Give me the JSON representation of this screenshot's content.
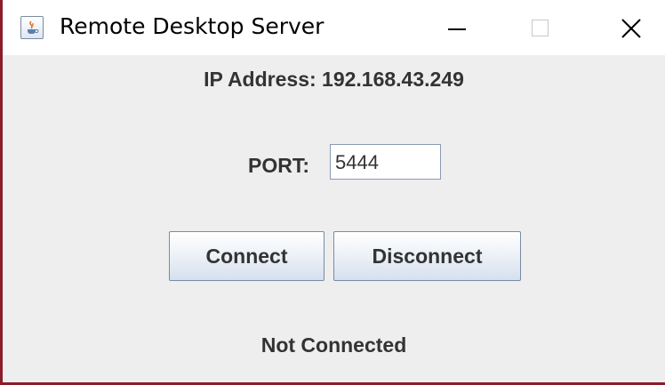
{
  "window": {
    "title": "Remote Desktop Server",
    "icon": "java-cup-icon",
    "controls": [
      "minimize-icon",
      "maximize-icon",
      "close-icon"
    ]
  },
  "content": {
    "ip_text": "IP Address: 192.168.43.249",
    "port_label": "PORT:",
    "port_value": "5444",
    "connect_label": "Connect",
    "disconnect_label": "Disconnect",
    "status_text": "Not Connected"
  },
  "colors": {
    "window_border": "#8a1c2c",
    "background": "#eeeeee",
    "text": "#333333"
  }
}
